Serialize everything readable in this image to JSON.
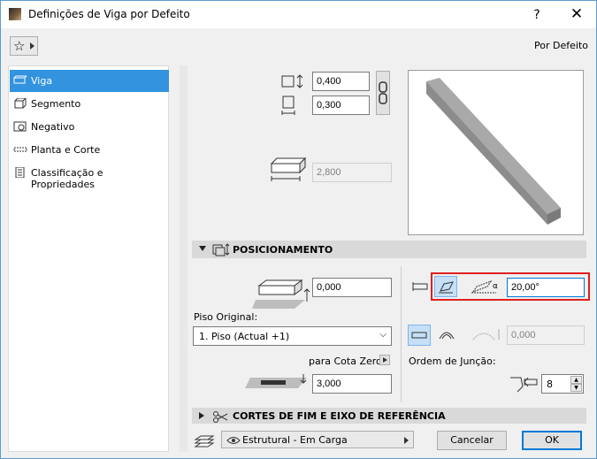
{
  "window": {
    "title": "Definições de Viga por Defeito",
    "help": "?",
    "close": "✕",
    "preset_label": "Por Defeito"
  },
  "sidebar": {
    "items": [
      {
        "label": "Viga",
        "icon": "beam-icon",
        "selected": true
      },
      {
        "label": "Segmento",
        "icon": "segment-icon",
        "selected": false
      },
      {
        "label": "Negativo",
        "icon": "hole-icon",
        "selected": false
      },
      {
        "label": "Planta e Corte",
        "icon": "plan-section-icon",
        "selected": false
      },
      {
        "label": "Classificação e Propriedades",
        "icon": "document-icon",
        "selected": false
      }
    ]
  },
  "geometry": {
    "height": "0,400",
    "width": "0,300",
    "length": "2,800"
  },
  "positioning": {
    "section_title": "POSICIONAMENTO",
    "offset": "0,000",
    "home_story_label": "Piso Original:",
    "home_story": "1. Piso (Actual +1)",
    "to_zero_label": "para Cota Zero",
    "to_zero": "3,000",
    "slant_angle": "20,00°",
    "curve_value": "0,000",
    "join_order_label": "Ordem de Junção:",
    "join_order": "8"
  },
  "end_cuts": {
    "section_title": "CORTES DE FIM E EIXO DE REFERÊNCIA"
  },
  "footer": {
    "structural": "Estrutural - Em Carga",
    "cancel": "Cancelar",
    "ok": "OK"
  },
  "colors": {
    "accent": "#3393df",
    "highlight_border": "#e02020",
    "section_bg": "#d9d9d9"
  }
}
